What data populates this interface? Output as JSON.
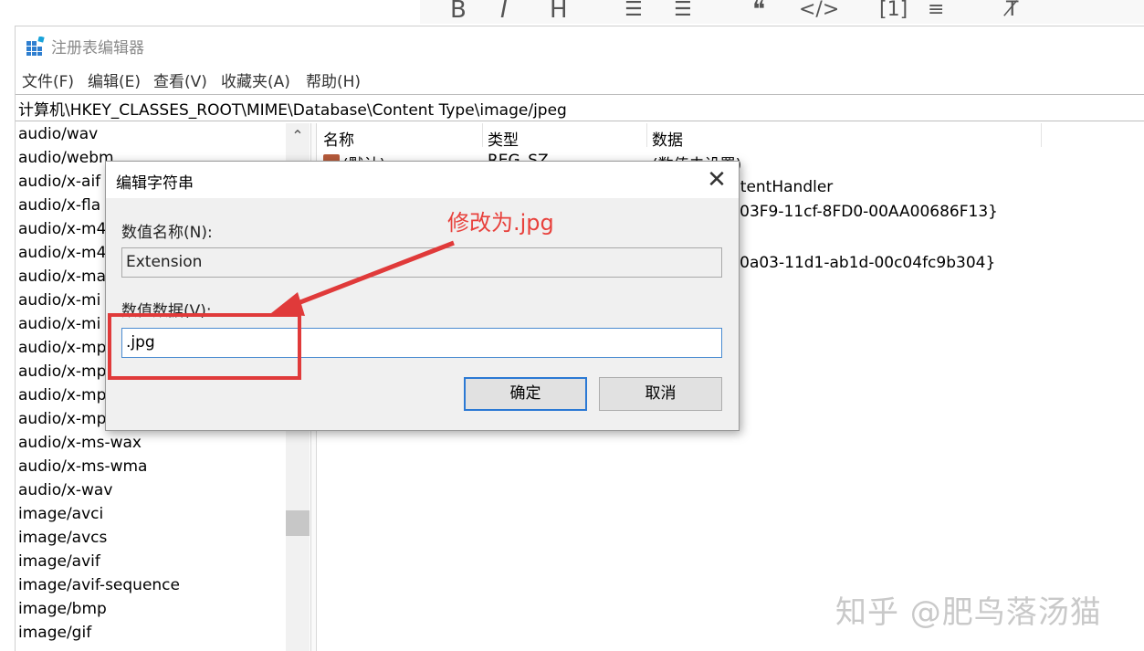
{
  "app": {
    "title": "注册表编辑器",
    "icon": "registry-icon"
  },
  "background_toolbar": {
    "icons": [
      "bold-icon",
      "italic-icon",
      "heading-icon",
      "ordered-list-icon",
      "unordered-list-icon",
      "quote-icon",
      "code-icon",
      "formula-icon",
      "divider-icon",
      "clear-format-icon"
    ]
  },
  "menu": [
    "文件(F)",
    "编辑(E)",
    "查看(V)",
    "收藏夹(A)",
    "帮助(H)"
  ],
  "address": "计算机\\HKEY_CLASSES_ROOT\\MIME\\Database\\Content Type\\image/jpeg",
  "tree": {
    "items": [
      "audio/wav",
      "audio/webm",
      "audio/x-aif",
      "audio/x-fla",
      "audio/x-m4",
      "audio/x-m4",
      "audio/x-ma",
      "audio/x-mi",
      "audio/x-mi",
      "audio/x-mp",
      "audio/x-mp",
      "audio/x-mp",
      "audio/x-mp",
      "audio/x-ms-wax",
      "audio/x-ms-wma",
      "audio/x-wav",
      "image/avci",
      "image/avcs",
      "image/avif",
      "image/avif-sequence",
      "image/bmp",
      "image/gif"
    ]
  },
  "list": {
    "columns": [
      "名称",
      "类型",
      "数据"
    ],
    "rows": [
      {
        "name": "(默认)",
        "type": "REG_SZ",
        "data": "(数值未设置)"
      },
      {
        "name": "",
        "type": "",
        "data": "ntentHandler"
      },
      {
        "name": "",
        "type": "",
        "data": "-03F9-11cf-8FD0-00AA00686F13}"
      },
      {
        "name": "",
        "type": "",
        "data": ""
      },
      {
        "name": "",
        "type": "",
        "data": "-0a03-11d1-ab1d-00c04fc9b304}"
      }
    ]
  },
  "dialog": {
    "title": "编辑字符串",
    "close_icon": "close-icon",
    "name_label": "数值名称(N):",
    "name_value": "Extension",
    "data_label": "数值数据(V):",
    "data_value": ".jpg",
    "ok_label": "确定",
    "cancel_label": "取消"
  },
  "annotation": {
    "text": "修改为.jpg",
    "color": "#e8413c"
  },
  "watermark": "知乎 @肥鸟落汤猫"
}
